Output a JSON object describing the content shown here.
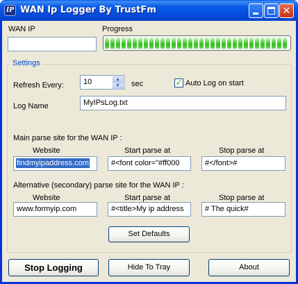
{
  "window": {
    "title": "WAN Ip Logger By TrustFm",
    "icon_text": "IP"
  },
  "top": {
    "wan_ip_label": "WAN IP",
    "wan_ip_value": "",
    "progress_label": "Progress",
    "progress_fraction": 1.0,
    "progress_color": "#2fbf1e"
  },
  "settings": {
    "group_label": "Settings",
    "refresh_label": "Refresh Every:",
    "refresh_value": "10",
    "refresh_unit": "sec",
    "auto_log_label": "Auto Log on start",
    "auto_log_checked": true,
    "log_name_label": "Log Name",
    "log_name_value": "MyIPsLog.txt",
    "main_site_heading": "Main parse site for the WAN IP :",
    "alt_site_heading": "Alternative (secondary) parse site for the WAN IP :",
    "col_website": "Website",
    "col_start": "Start parse at",
    "col_stop": "Stop parse at",
    "main": {
      "website": "findmyipaddress.com",
      "start": "#<font color=\"#ff000",
      "stop": "#</font>#"
    },
    "alt": {
      "website": "www.formyip.com",
      "start": "#<title>My ip address",
      "stop": "# The quick#"
    },
    "set_defaults_label": "Set Defaults"
  },
  "buttons": {
    "stop_logging": "Stop Logging",
    "hide_to_tray": "Hide To Tray",
    "about": "About"
  },
  "colors": {
    "title_bar": "#0650e0",
    "client_bg": "#ece9d8",
    "group_label": "#0046d5",
    "selection": "#316ac5"
  }
}
